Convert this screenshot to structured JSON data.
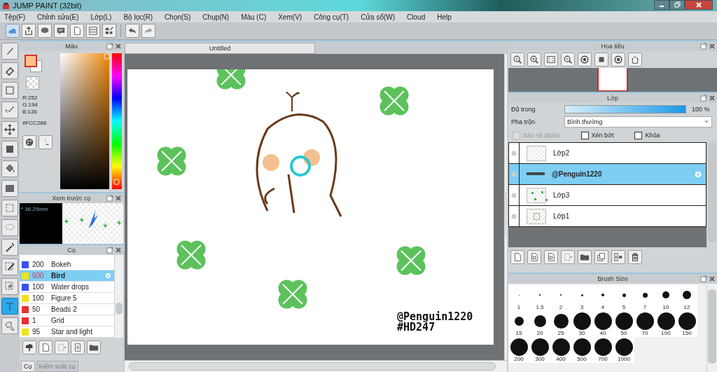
{
  "window": {
    "title": "JUMP PAINT (32bit)"
  },
  "menu": [
    "Tệp(F)",
    "Chỉnh sửa(E)",
    "Lớp(L)",
    "Bộ lọc(R)",
    "Chọn(S)",
    "Chụp(N)",
    "Màu (C)",
    "Xem(V)",
    "Công cụ(T)",
    "Cửa sổ(W)",
    "Cloud",
    "Help"
  ],
  "tools": [
    {
      "kind": "brush",
      "selected": false
    },
    {
      "kind": "eraser",
      "selected": false
    },
    {
      "kind": "rectangle",
      "selected": false
    },
    {
      "kind": "dotted-line",
      "selected": false
    },
    {
      "kind": "move",
      "selected": false
    },
    {
      "kind": "fill-square",
      "selected": false
    },
    {
      "kind": "bucket",
      "selected": false
    },
    {
      "kind": "gradient",
      "selected": false
    },
    {
      "kind": "rect-select",
      "selected": false
    },
    {
      "kind": "lasso",
      "selected": false
    },
    {
      "kind": "wand",
      "selected": false
    },
    {
      "kind": "select-pen",
      "selected": false
    },
    {
      "kind": "select-eraser",
      "selected": false
    },
    {
      "kind": "text",
      "selected": true
    },
    {
      "kind": "select-arrow",
      "selected": false
    }
  ],
  "color_panel": {
    "title": "Màu",
    "hue_slider": {
      "level": 0.04
    },
    "r": "R:252",
    "g": "G:194",
    "b": "B:136",
    "hex": "#FCC288"
  },
  "brush_preview": {
    "title": "Xem trước cọ",
    "size": "* 36.29mm"
  },
  "brush_panel": {
    "title": "Cọ",
    "brushes": [
      {
        "size": "200",
        "name": "Bokeh",
        "color": "#3a4ff0",
        "selected": false
      },
      {
        "size": "500",
        "name": "Bird",
        "color": "#f2e01a",
        "selected": true
      },
      {
        "size": "100",
        "name": "Water drops",
        "color": "#3a4ff0",
        "selected": false
      },
      {
        "size": "100",
        "name": "Figure 5",
        "color": "#f2e01a",
        "selected": false
      },
      {
        "size": "50",
        "name": "Beads 2",
        "color": "#e83030",
        "selected": false
      },
      {
        "size": "1",
        "name": "Grid",
        "color": "#e83030",
        "selected": false
      },
      {
        "size": "95",
        "name": "Star and light",
        "color": "#f2e01a",
        "selected": false
      }
    ],
    "tabs": [
      {
        "label": "Cọ",
        "selected": true
      },
      {
        "label": "Kiểm soát cọ",
        "selected": false
      }
    ]
  },
  "document": {
    "tab": "Untitled",
    "canvas_text": [
      "@Penguin1220",
      "#HD247"
    ]
  },
  "navigator": {
    "title": "Hoa tiêu"
  },
  "layer_panel": {
    "title": "Lớp",
    "opacity_label": "Độ trong",
    "opacity": {
      "level": 1.0,
      "reading": "100 %"
    },
    "blend_label": "Pha trộn",
    "blend_value": "Bình thường",
    "options": [
      {
        "label": "Bảo vệ alpha",
        "checked": false,
        "disabled": true
      },
      {
        "label": "Xén bớt",
        "checked": false,
        "disabled": false
      },
      {
        "label": "Khóa",
        "checked": false,
        "disabled": false
      }
    ],
    "layers": [
      {
        "name": "Lớp2",
        "kind": "empty",
        "selected": false
      },
      {
        "name": "@Penguin1220",
        "kind": "text",
        "selected": true
      },
      {
        "name": "Lớp3",
        "kind": "clovers",
        "selected": false
      },
      {
        "name": "Lớp1",
        "kind": "sketch",
        "selected": false
      }
    ]
  },
  "brush_size_panel": {
    "title": "Brush Size",
    "sizes": [
      "1",
      "1.5",
      "2",
      "3",
      "4",
      "5",
      "7",
      "10",
      "12",
      "15",
      "20",
      "25",
      "30",
      "40",
      "50",
      "70",
      "100",
      "150",
      "200",
      "300",
      "400",
      "500",
      "700",
      "1000"
    ]
  }
}
